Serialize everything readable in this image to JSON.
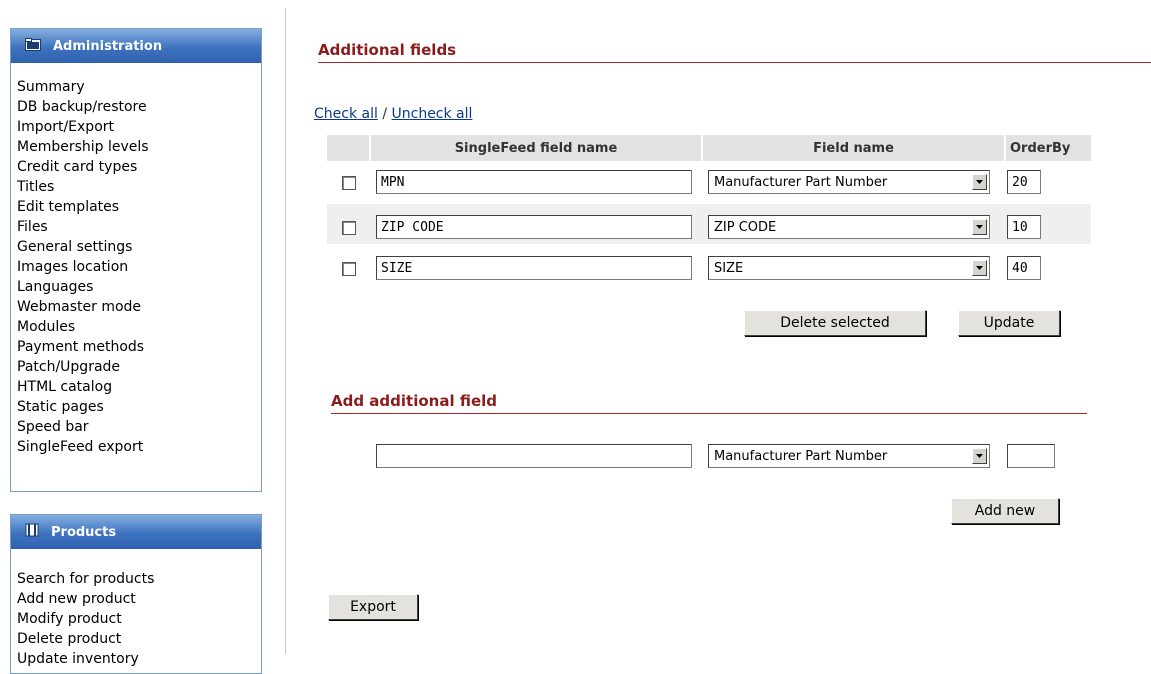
{
  "sidebar": {
    "admin": {
      "title": "Administration",
      "icon": "folder-icon",
      "items": [
        "Summary",
        "DB backup/restore",
        "Import/Export",
        "Membership levels",
        "Credit card types",
        "Titles",
        "Edit templates",
        "Files",
        "General settings",
        "Images location",
        "Languages",
        "Webmaster mode",
        "Modules",
        "Payment methods",
        "Patch/Upgrade",
        "HTML catalog",
        "Static pages",
        "Speed bar",
        "SingleFeed export"
      ]
    },
    "products": {
      "title": "Products",
      "icon": "book-icon",
      "items": [
        "Search for products",
        "Add new product",
        "Modify product",
        "Delete product",
        "Update inventory"
      ]
    }
  },
  "main": {
    "additional_fields_title": "Additional fields",
    "check_all": "Check all",
    "separator": "/",
    "uncheck_all": "Uncheck all",
    "columns": [
      "SingleFeed field name",
      "Field name",
      "OrderBy"
    ],
    "rows": [
      {
        "singlefeed_name": "MPN",
        "field_name": "Manufacturer Part Number",
        "order_by": "20",
        "checked": false
      },
      {
        "singlefeed_name": "ZIP CODE",
        "field_name": "ZIP CODE",
        "order_by": "10",
        "checked": false
      },
      {
        "singlefeed_name": "SIZE",
        "field_name": "SIZE",
        "order_by": "40",
        "checked": false
      }
    ],
    "delete_selected_label": "Delete selected",
    "update_label": "Update",
    "add_title": "Add additional field",
    "add_form": {
      "singlefeed_name": "",
      "field_name": "Manufacturer Part Number",
      "order_by": ""
    },
    "add_new_label": "Add new",
    "export_label": "Export"
  },
  "colors": {
    "section_title": "#8b1c1c",
    "menu_header": "#3d72bf",
    "link": "#0a3a8c",
    "table_header_bg": "#e3e3e3"
  }
}
